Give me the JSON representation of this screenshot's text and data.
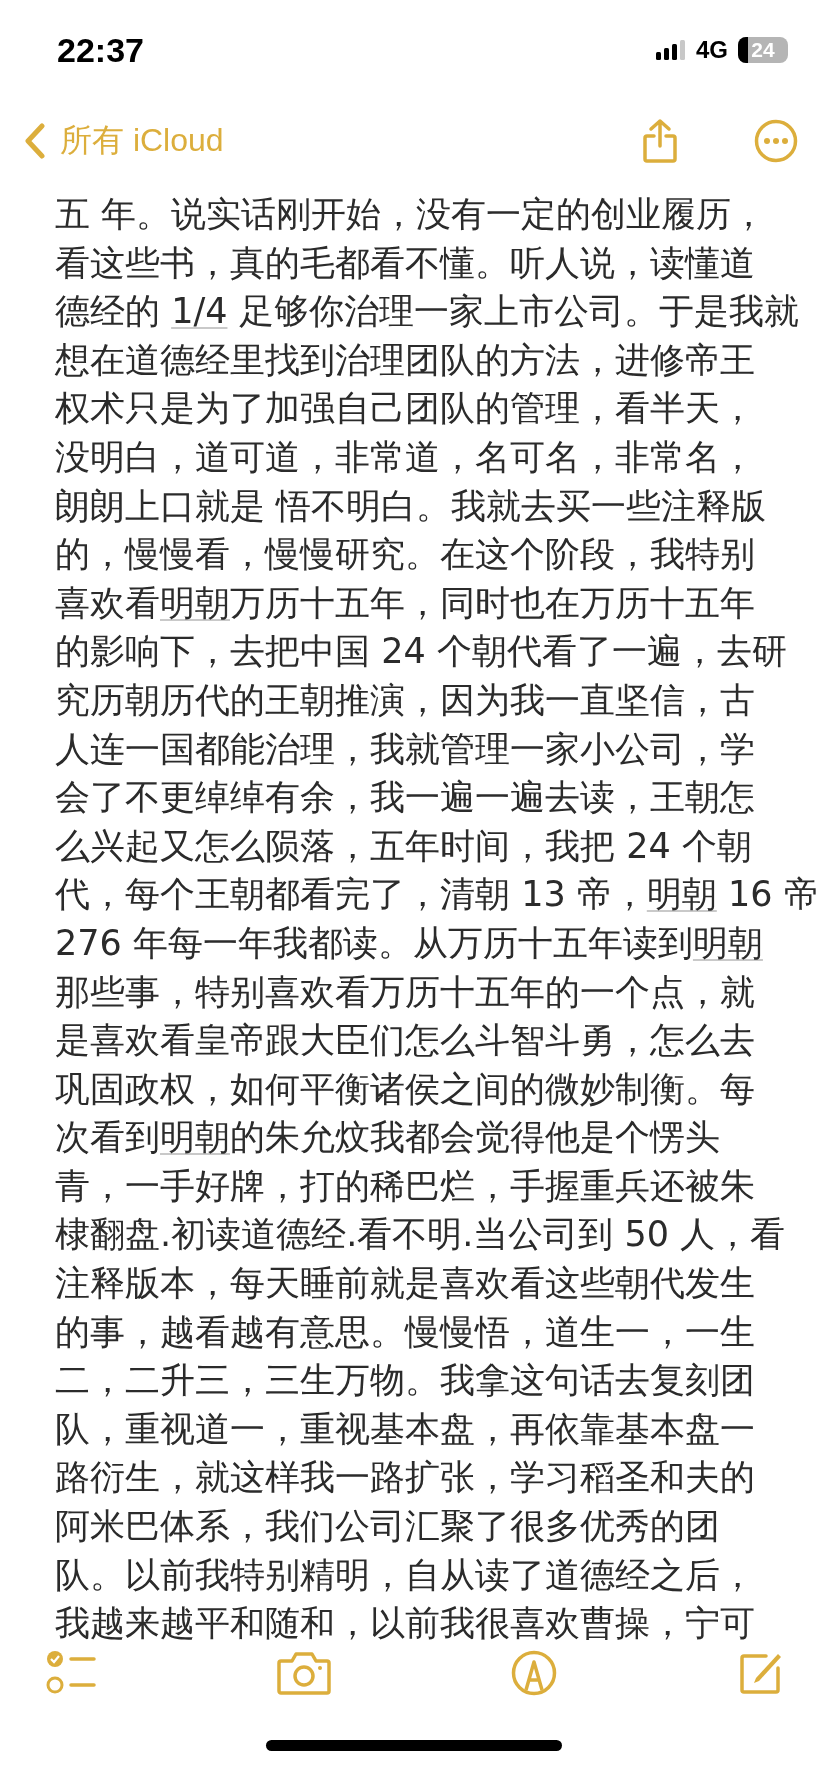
{
  "status_bar": {
    "time": "22:37",
    "network": "4G",
    "battery": "24"
  },
  "nav": {
    "back_label": "所有 iCloud"
  },
  "note": {
    "lines": [
      [
        {
          "text": "五 年。说实话刚开始，没有一定的创业履历，",
          "underlined": false
        }
      ],
      [
        {
          "text": "看这些书，真的毛都看不懂。听人说，读懂道",
          "underlined": false
        }
      ],
      [
        {
          "text": "德经的 ",
          "underlined": false
        },
        {
          "text": "1/4",
          "underlined": true
        },
        {
          "text": " 足够你治理一家上市公司。于是我就",
          "underlined": false
        }
      ],
      [
        {
          "text": "想在道德经里找到治理团队的方法，进修帝王",
          "underlined": false
        }
      ],
      [
        {
          "text": "权术只是为了加强自己团队的管理，看半天，",
          "underlined": false
        }
      ],
      [
        {
          "text": "没明白，道可道，非常道，名可名，非常名，",
          "underlined": false
        }
      ],
      [
        {
          "text": "朗朗上口就是 悟不明白。我就去买一些注释版",
          "underlined": false
        }
      ],
      [
        {
          "text": "的，慢慢看，慢慢研究。在这个阶段，我特别",
          "underlined": false
        }
      ],
      [
        {
          "text": "喜欢看",
          "underlined": false
        },
        {
          "text": "明朝",
          "underlined": true
        },
        {
          "text": "万历十五年，同时也在万历十五年",
          "underlined": false
        }
      ],
      [
        {
          "text": "的影响下，去把中国 24 个朝代看了一遍，去研",
          "underlined": false
        }
      ],
      [
        {
          "text": "究历朝历代的王朝推演，因为我一直坚信，古",
          "underlined": false
        }
      ],
      [
        {
          "text": "人连一国都能治理，我就管理一家小公司，学",
          "underlined": false
        }
      ],
      [
        {
          "text": "会了不更绰绰有余，我一遍一遍去读，王朝怎",
          "underlined": false
        }
      ],
      [
        {
          "text": "么兴起又怎么陨落，五年时间，我把 24 个朝",
          "underlined": false
        }
      ],
      [
        {
          "text": "代，每个王朝都看完了，清朝 13 帝，",
          "underlined": false
        },
        {
          "text": "明朝",
          "underlined": true
        },
        {
          "text": " 16 帝",
          "underlined": false
        }
      ],
      [
        {
          "text": "276 年每一年我都读。从万历十五年读到",
          "underlined": false
        },
        {
          "text": "明朝",
          "underlined": true
        }
      ],
      [
        {
          "text": "那些事，特别喜欢看万历十五年的一个点，就",
          "underlined": false
        }
      ],
      [
        {
          "text": "是喜欢看皇帝跟大臣们怎么斗智斗勇，怎么去",
          "underlined": false
        }
      ],
      [
        {
          "text": "巩固政权，如何平衡诸侯之间的微妙制衡。每",
          "underlined": false
        }
      ],
      [
        {
          "text": "次看到",
          "underlined": false
        },
        {
          "text": "明朝",
          "underlined": true
        },
        {
          "text": "的朱允炆我都会觉得他是个愣头",
          "underlined": false
        }
      ],
      [
        {
          "text": "青，一手好牌，打的稀巴烂，手握重兵还被朱",
          "underlined": false
        }
      ],
      [
        {
          "text": "棣翻盘.初读道德经.看不明.当公司到 50 人，看",
          "underlined": false
        }
      ],
      [
        {
          "text": "注释版本，每天睡前就是喜欢看这些朝代发生",
          "underlined": false
        }
      ],
      [
        {
          "text": "的事，越看越有意思。慢慢悟，道生一，一生",
          "underlined": false
        }
      ],
      [
        {
          "text": "二，二升三，三生万物。我拿这句话去复刻团",
          "underlined": false
        }
      ],
      [
        {
          "text": "队，重视道一，重视基本盘，再依靠基本盘一",
          "underlined": false
        }
      ],
      [
        {
          "text": "路衍生，就这样我一路扩张，学习稻圣和夫的",
          "underlined": false
        }
      ],
      [
        {
          "text": "阿米巴体系，我们公司汇聚了很多优秀的团",
          "underlined": false
        }
      ],
      [
        {
          "text": "队。以前我特别精明，自从读了道德经之后，",
          "underlined": false
        }
      ],
      [
        {
          "text": "我越来越平和随和，以前我很喜欢曹操，宁可",
          "underlined": false
        }
      ]
    ]
  }
}
